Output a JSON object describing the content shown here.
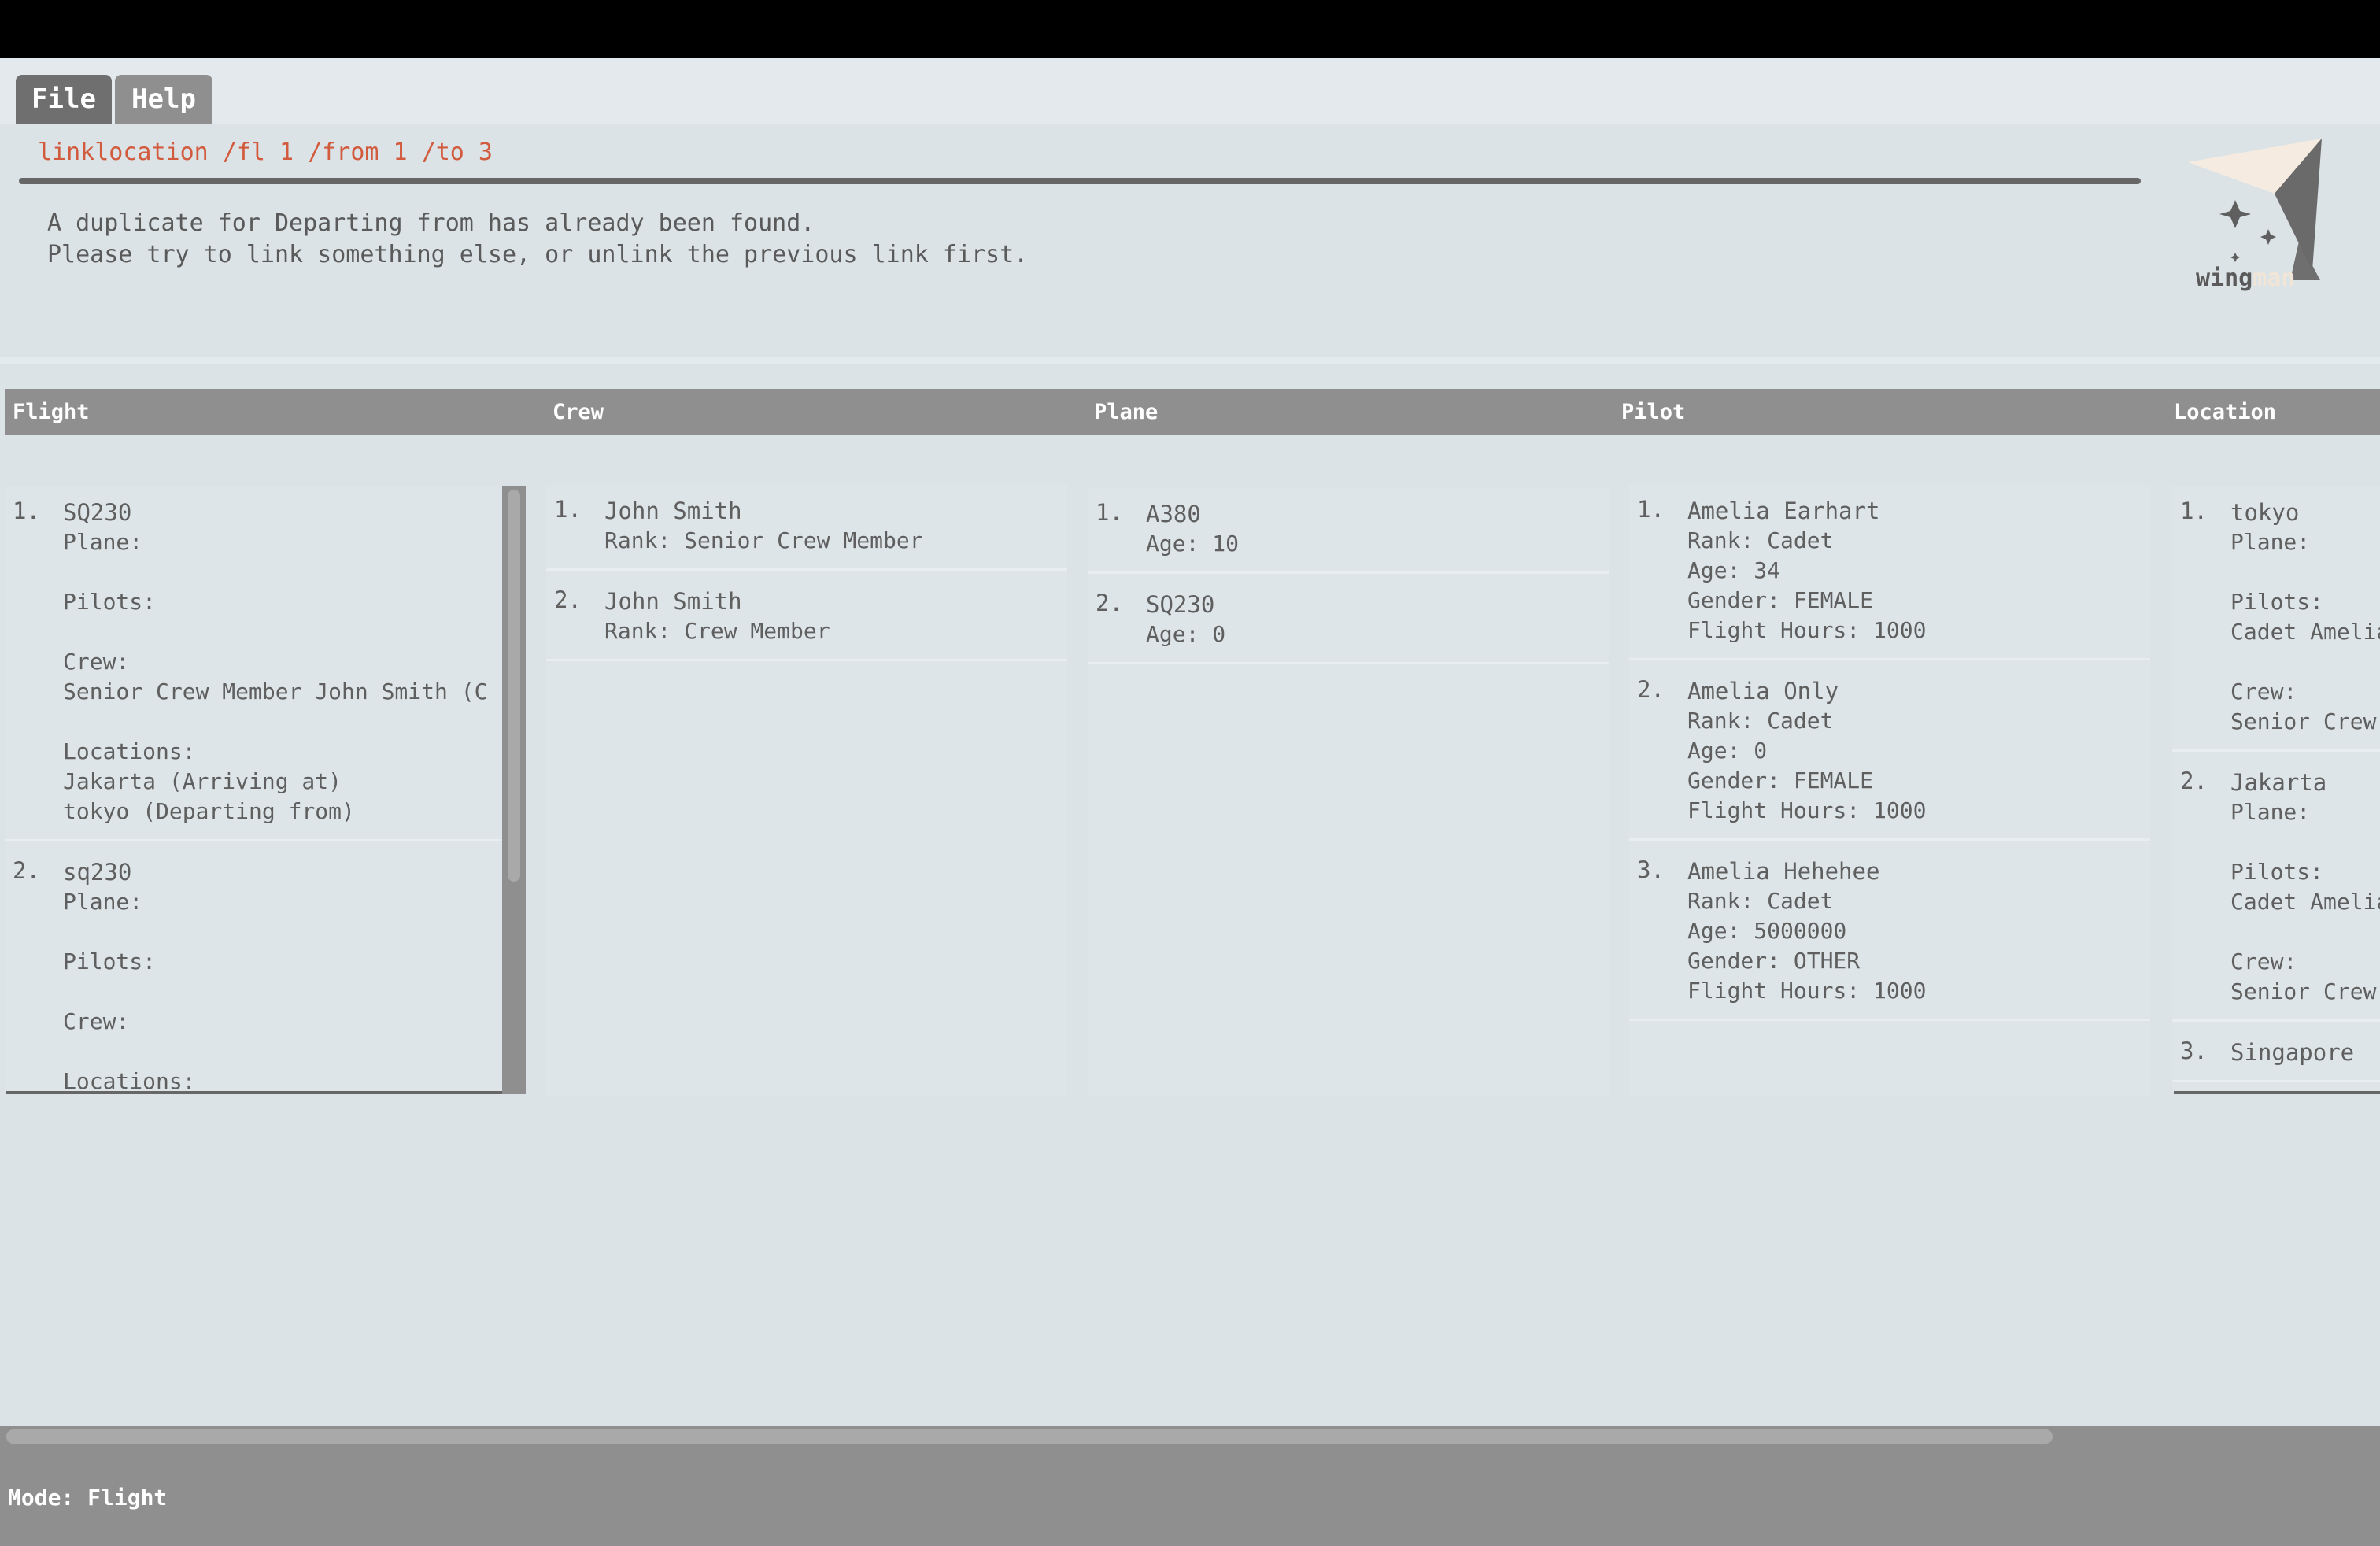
{
  "menu": {
    "file_label": "File",
    "help_label": "Help"
  },
  "command": {
    "text": "linklocation /fl 1 /from 1 /to 3"
  },
  "result": {
    "line1": "A duplicate for Departing from has already been found.",
    "line2": "Please try to link something else, or unlink the previous link first."
  },
  "logo": {
    "text_main": "wing",
    "text_faded": "man"
  },
  "columns": {
    "flight": "Flight",
    "crew": "Crew",
    "plane": "Plane",
    "pilot": "Pilot",
    "location": "Location"
  },
  "flights": [
    {
      "index": "1.",
      "title": "SQ230",
      "lines": "Plane:\n\nPilots:\n\nCrew:\nSenior Crew Member John Smith (C\n\nLocations:\nJakarta (Arriving at)\ntokyo (Departing from)"
    },
    {
      "index": "2.",
      "title": "sq230",
      "lines": "Plane:\n\nPilots:\n\nCrew:\n\nLocations:"
    }
  ],
  "crew": [
    {
      "index": "1.",
      "title": "John Smith",
      "lines": "Rank: Senior Crew Member"
    },
    {
      "index": "2.",
      "title": "John Smith",
      "lines": "Rank: Crew Member"
    }
  ],
  "planes": [
    {
      "index": "1.",
      "title": "A380",
      "lines": "Age: 10"
    },
    {
      "index": "2.",
      "title": "SQ230",
      "lines": "Age: 0"
    }
  ],
  "pilots": [
    {
      "index": "1.",
      "title": "Amelia Earhart",
      "lines": "Rank: Cadet\nAge: 34\nGender: FEMALE\nFlight Hours: 1000"
    },
    {
      "index": "2.",
      "title": "Amelia Only",
      "lines": "Rank: Cadet\nAge: 0\nGender: FEMALE\nFlight Hours: 1000"
    },
    {
      "index": "3.",
      "title": "Amelia Hehehee",
      "lines": "Rank: Cadet\nAge: 5000000\nGender: OTHER\nFlight Hours: 1000"
    }
  ],
  "locations": [
    {
      "index": "1.",
      "title": "tokyo",
      "lines": "Plane:\n\nPilots:\nCadet Amelia\n\nCrew:\nSenior Crew"
    },
    {
      "index": "2.",
      "title": "Jakarta",
      "lines": "Plane:\n\nPilots:\nCadet Amelia\n\nCrew:\nSenior Crew"
    },
    {
      "index": "3.",
      "title": "Singapore",
      "lines": ""
    }
  ],
  "status": {
    "text": "Mode: Flight"
  },
  "colors": {
    "command": "#d25a3d",
    "bar": "#8f8f8f",
    "background": "#dbe3e6"
  }
}
